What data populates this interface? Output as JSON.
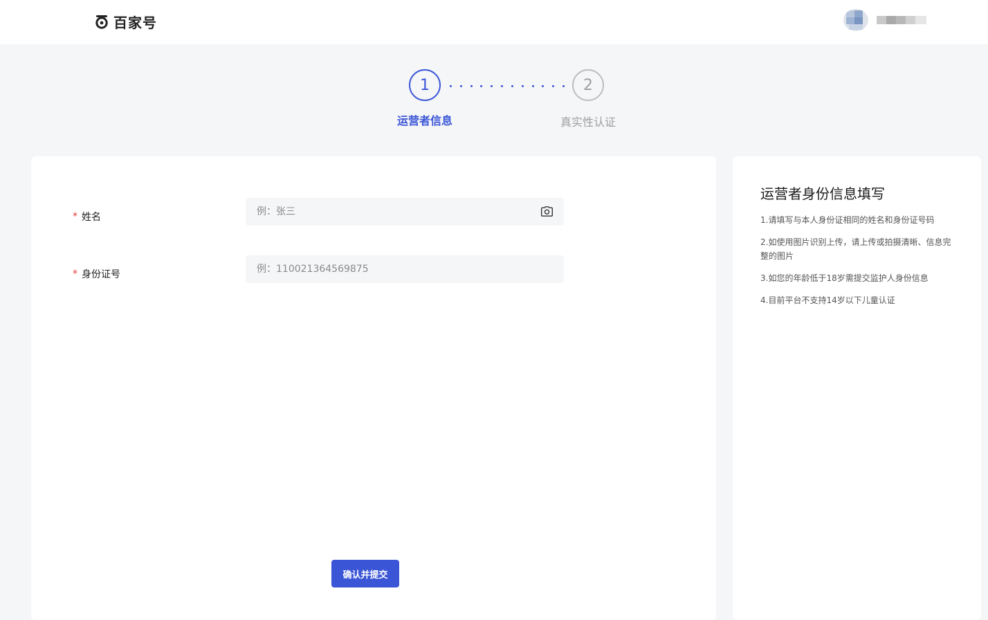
{
  "header": {
    "logo_text": "百家号",
    "colors": {
      "accent": "#3a55d6",
      "required": "#e53935",
      "background": "#f5f6f8"
    }
  },
  "steps": [
    {
      "number": "1",
      "label": "运营者信息",
      "state": "active"
    },
    {
      "number": "2",
      "label": "真实性认证",
      "state": "inactive"
    }
  ],
  "form": {
    "name": {
      "label": "姓名",
      "required_mark": "*",
      "placeholder": "例：张三",
      "value": ""
    },
    "id_number": {
      "label": "身份证号",
      "required_mark": "*",
      "placeholder": "例：110021364569875",
      "value": ""
    },
    "submit_label": "确认并提交"
  },
  "side": {
    "title": "运营者身份信息填写",
    "items": [
      "1.请填写与本人身份证相同的姓名和身份证号码",
      "2.如使用图片识别上传，请上传或拍摄清晰、信息完整的图片",
      "3.如您的年龄低于18岁需提交监护人身份信息",
      "4.目前平台不支持14岁以下儿童认证"
    ]
  }
}
